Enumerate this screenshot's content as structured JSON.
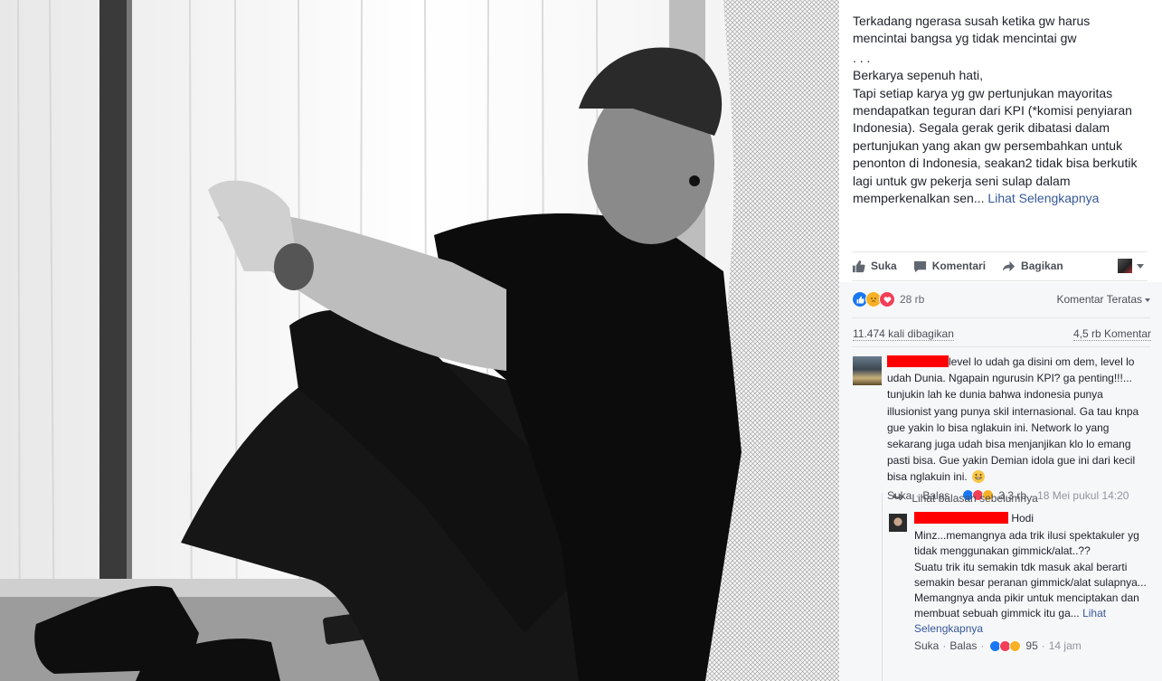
{
  "post": {
    "caption_lines": [
      "Terkadang ngerasa susah ketika gw harus mencintai bangsa yg tidak mencintai gw",
      ". . .",
      "Berkarya sepenuh hati,",
      "Tapi setiap karya yg gw pertunjukan mayoritas mendapatkan teguran dari KPI (*komisi penyiaran Indonesia). Segala gerak gerik dibatasi dalam pertunjukan yang akan gw persembahkan untuk penonton di Indonesia, seakan2 tidak bisa berkutik lagi untuk gw pekerja seni sulap dalam memperkenalkan sen..."
    ],
    "see_more": "Lihat Selengkapnya"
  },
  "actions": {
    "like": "Suka",
    "comment": "Komentari",
    "share": "Bagikan"
  },
  "reactions": {
    "count": "28 rb",
    "sort_label": "Komentar Teratas"
  },
  "stats": {
    "shares": "11.474 kali dibagikan",
    "comments": "4,5 rb Komentar"
  },
  "comments": [
    {
      "text": "level lo udah ga disini om dem, level lo udah Dunia. Ngapain ngurusin KPI? ga penting!!!... tunjukin lah ke dunia bahwa indonesia punya illusionist yang punya skil internasional. Ga tau knpa gue yakin lo bisa nglakuin ini. Network lo yang sekarang juga udah bisa menjanjikan klo lo emang pasti bisa. Gue yakin Demian idola gue ini dari kecil bisa nglakuin ini.",
      "like": "Suka",
      "reply": "Balas",
      "reactions": "3,3 rb",
      "time": "18 Mei pukul 14:20"
    }
  ],
  "view_previous_replies": "Lihat balasan sebelumnya",
  "reply": {
    "name_suffix": "Hodi",
    "lines": [
      "Minz...memangnya ada trik ilusi spektakuler yg tidak menggunakan gimmick/alat..??",
      "Suatu trik itu semakin tdk masuk akal berarti semakin besar peranan gimmick/alat sulapnya...",
      "Memangnya anda pikir untuk menciptakan dan membuat sebuah gimmick itu ga..."
    ],
    "see_more": "Lihat Selengkapnya",
    "like": "Suka",
    "reply": "Balas",
    "reactions": "95",
    "time": "14 jam"
  },
  "separator": "·",
  "colors": {
    "link": "#365899",
    "redaction": "#ff0000",
    "like_blue": "#1877f2",
    "love_red": "#f33e58",
    "sad_yellow": "#f7b125"
  }
}
